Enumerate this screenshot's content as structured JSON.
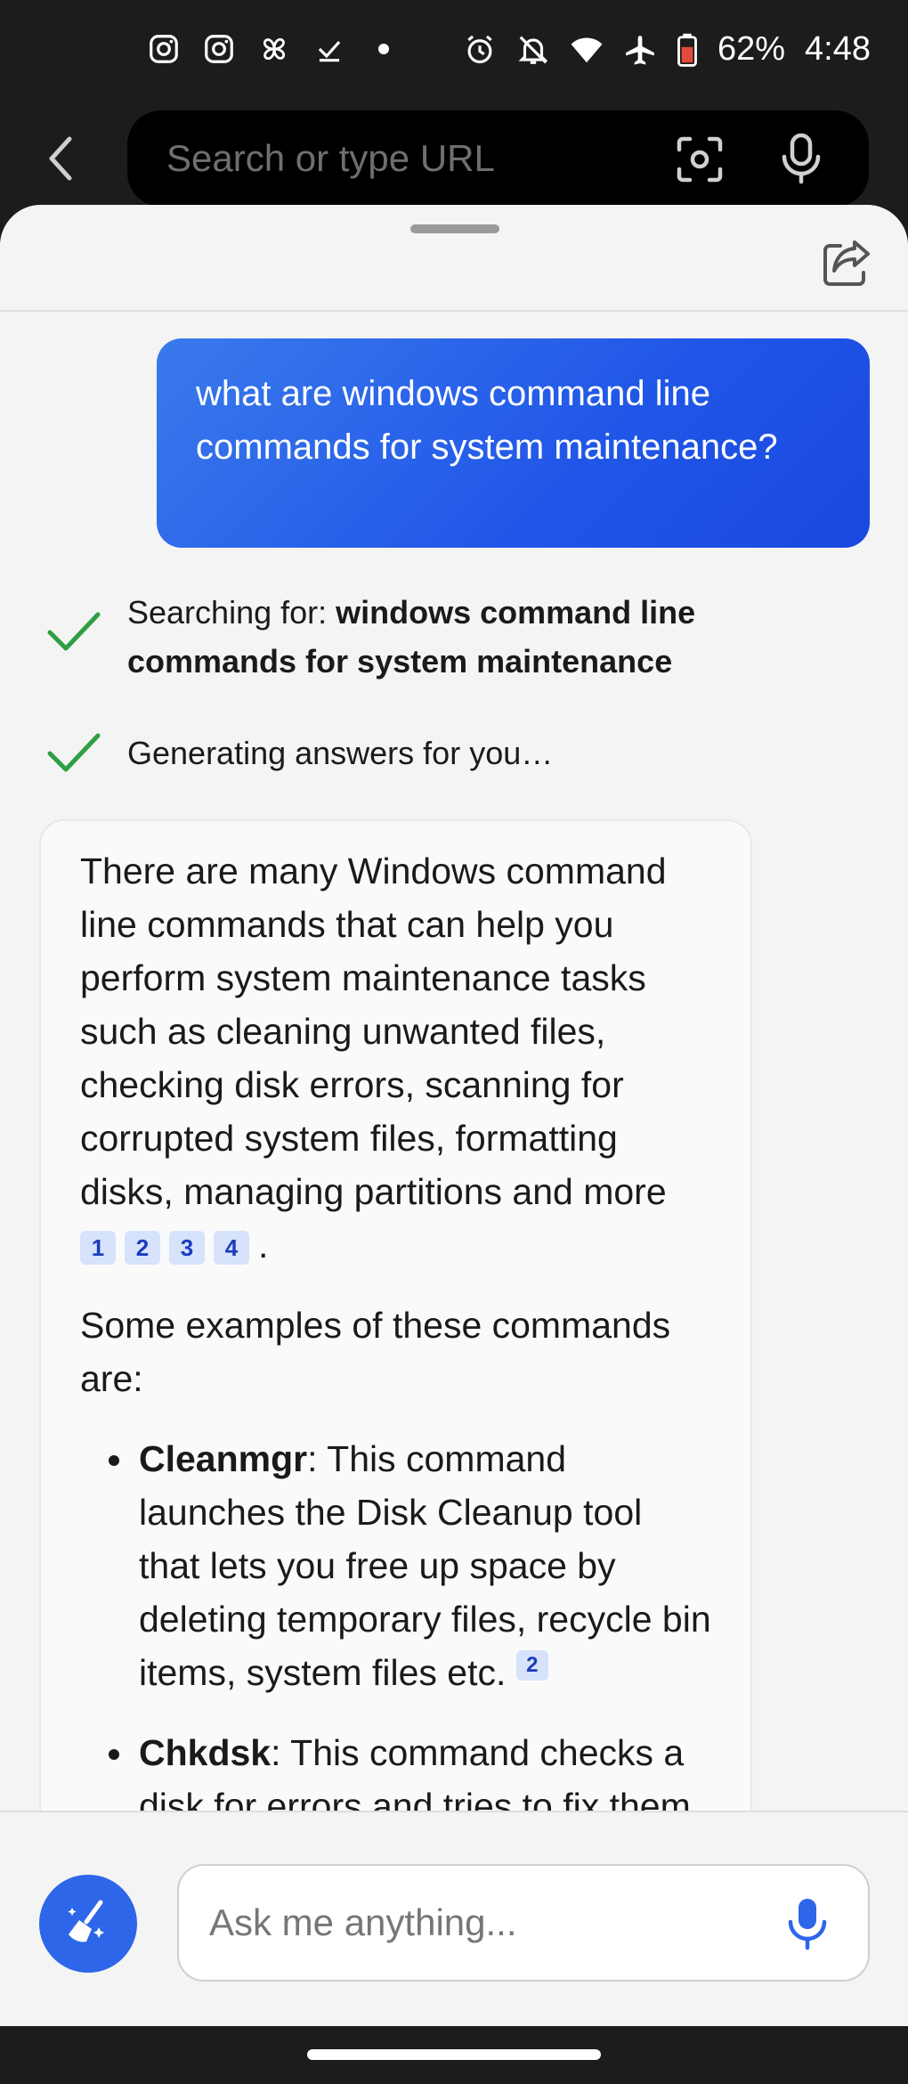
{
  "status_bar": {
    "battery": "62%",
    "time": "4:48",
    "left_icons": [
      "instagram-icon",
      "instagram-icon",
      "pinwheel-icon",
      "check-icon",
      "dot-icon"
    ],
    "right_icons": [
      "alarm-icon",
      "mute-icon",
      "wifi-icon",
      "airplane-icon",
      "battery-icon"
    ]
  },
  "browser": {
    "url_placeholder": "Search or type URL"
  },
  "chat": {
    "user_message": "what are windows command line commands for system maintenance?",
    "steps": [
      {
        "label": "Searching for: ",
        "query": "windows command line commands for system maintenance"
      },
      {
        "label": "Generating answers for you…"
      }
    ],
    "answer": {
      "intro": "There are many Windows command line commands that can help you perform system maintenance tasks such as cleaning unwanted files, checking disk errors, scanning for corrupted system files, formatting disks, managing partitions and more",
      "intro_citations": [
        "1",
        "2",
        "3",
        "4"
      ],
      "intro_end": ".",
      "examples_heading": "Some examples of these commands are:",
      "items": [
        {
          "name": "Cleanmgr",
          "desc": ": This command launches the Disk Cleanup tool that lets you free up space by deleting temporary files, recycle bin items, system files etc.",
          "citation": "2"
        },
        {
          "name": "Chkdsk",
          "desc": ": This command checks a disk for errors and tries to fix them"
        }
      ]
    },
    "input_placeholder": "Ask me anything..."
  },
  "colors": {
    "accent": "#2D66E8",
    "user_bubble": "#2056E8",
    "check": "#2EA043",
    "citation_bg": "#D7E2FB",
    "citation_text": "#1A3DBD"
  }
}
